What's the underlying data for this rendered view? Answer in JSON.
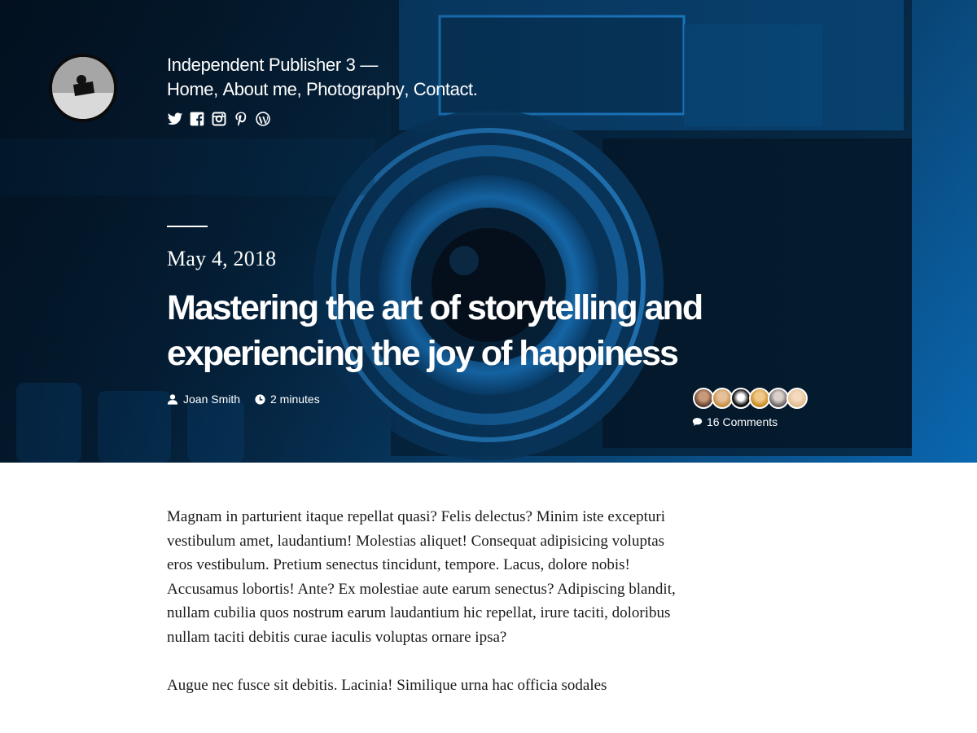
{
  "site": {
    "title": "Independent Publisher 3 —",
    "nav": [
      "Home",
      "About me",
      "Photography",
      "Contact"
    ],
    "social_icons": [
      "twitter-icon",
      "facebook-icon",
      "instagram-icon",
      "pinterest-icon",
      "wordpress-icon"
    ]
  },
  "post": {
    "date": "May 4, 2018",
    "title": "Mastering the art of storytelling and experiencing the joy of happiness",
    "author": "Joan Smith",
    "reading_time": "2 minutes",
    "comments": "16 Comments",
    "commenter_avatars": 6
  },
  "content": {
    "paragraphs": [
      "Magnam in parturient itaque repellat quasi? Felis delectus? Minim iste excepturi vestibulum amet, laudantium! Molestias aliquet! Consequat adipisicing voluptas eros vestibulum. Pretium senectus tincidunt, tempore. Lacus, dolore nobis! Accusamus lobortis! Ante? Ex molestiae aute earum senectus? Adipiscing blandit, nullam cubilia quos nostrum earum laudantium hic repellat, irure taciti, doloribus nullam taciti debitis curae iaculis voluptas ornare ipsa?",
      "Augue nec fusce sit debitis. Lacinia! Similique urna hac officia sodales"
    ]
  },
  "colors": {
    "hero_tint": "#0b6cb8",
    "hero_dark": "#031525",
    "text_light": "#ffffff",
    "body_text": "#1a1a1a"
  }
}
